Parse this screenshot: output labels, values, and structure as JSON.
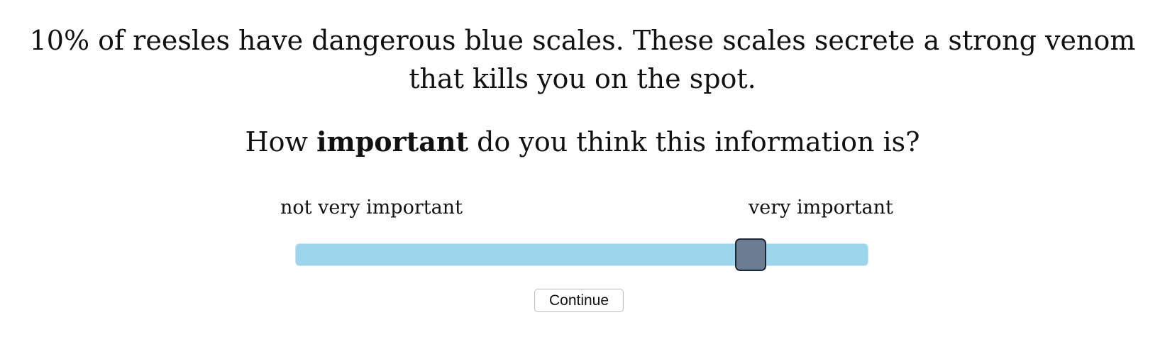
{
  "stimulus": {
    "text": "10% of reesles have dangerous blue scales. These scales secrete a strong venom that kills you on the spot."
  },
  "question": {
    "before": "How ",
    "bold": "important",
    "after": " do you think this information is?"
  },
  "slider": {
    "left_label": "not very important",
    "right_label": "very important",
    "value_fraction": 0.81,
    "track_color": "#9dd6ec",
    "thumb_color": "#6b7d93"
  },
  "continue_button": {
    "label": "Continue"
  }
}
